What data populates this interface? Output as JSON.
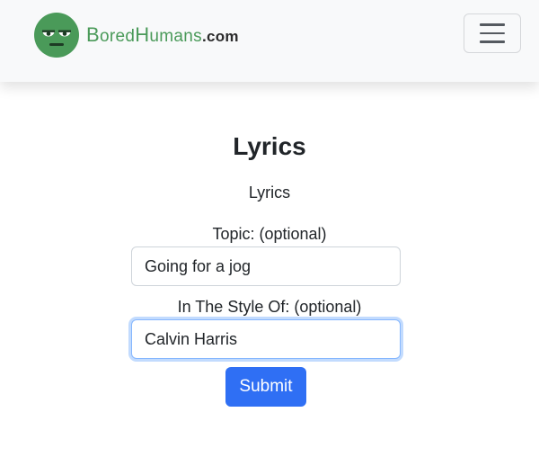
{
  "header": {
    "brand": {
      "name_part1_initial": "B",
      "name_part1_rest": "ored",
      "name_part2_initial": "H",
      "name_part2_rest": "umans",
      "suffix": ".com",
      "logo_icon": "bored-face-icon",
      "brand_color": "#4a9a59"
    },
    "menu_icon": "hamburger-menu-icon"
  },
  "main": {
    "title": "Lyrics",
    "subtitle": "Lyrics",
    "topic": {
      "label": "Topic: (optional)",
      "value": "Going for a jog"
    },
    "style": {
      "label": "In The Style Of: (optional)",
      "value": "Calvin Harris"
    },
    "submit_label": "Submit",
    "accent_color": "#2f6ff4"
  }
}
